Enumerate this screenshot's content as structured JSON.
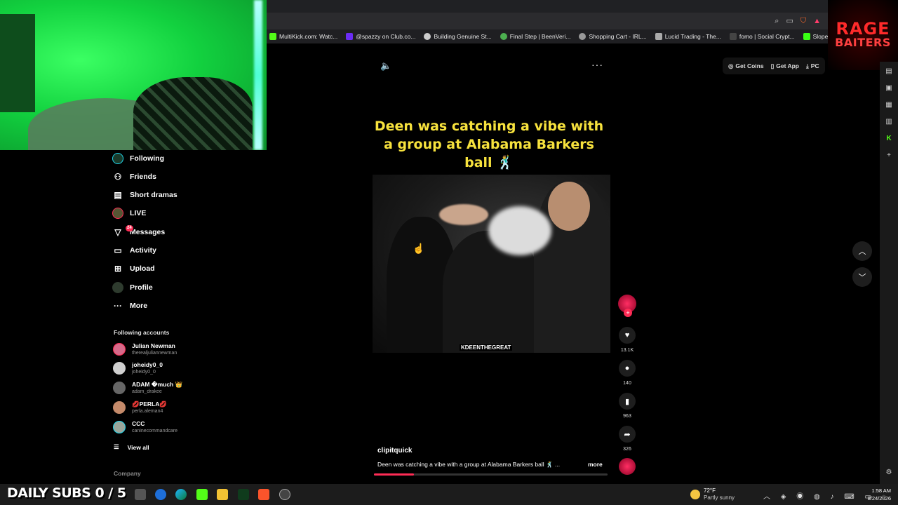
{
  "browser": {
    "bookmarks": [
      {
        "label": "MultiKick.com: Watc...",
        "icon": "kick-icon",
        "color": "#53fc18"
      },
      {
        "label": "@spazzy on Club.co...",
        "icon": "club-icon",
        "color": "#6b2cf5"
      },
      {
        "label": "Building Genuine St...",
        "icon": "doc-icon",
        "color": "#cccccc"
      },
      {
        "label": "Final Step | BeenVeri...",
        "icon": "beenverified-icon",
        "color": "#4caf50"
      },
      {
        "label": "Shopping Cart - IRL...",
        "icon": "globe-icon",
        "color": "#999999"
      },
      {
        "label": "Lucid Trading - The...",
        "icon": "lucid-icon",
        "color": "#aaaaaa"
      },
      {
        "label": "fomo | Social Crypt...",
        "icon": "fomo-icon",
        "color": "#222222"
      },
      {
        "label": "Slope Game",
        "icon": "slope-icon",
        "color": "#39ff14"
      }
    ]
  },
  "overlay": {
    "logo_top": "RAGE",
    "logo_bottom": "BAITERS",
    "daily_subs": "DAILY SUBS 0 / 5"
  },
  "sidebar": {
    "nav": [
      {
        "label": "Following",
        "icon": "following-avatar-icon"
      },
      {
        "label": "Friends",
        "icon": "friends-icon"
      },
      {
        "label": "Short dramas",
        "icon": "short-dramas-icon"
      },
      {
        "label": "LIVE",
        "icon": "live-icon"
      },
      {
        "label": "Messages",
        "icon": "messages-icon",
        "badge": "24"
      },
      {
        "label": "Activity",
        "icon": "activity-icon"
      },
      {
        "label": "Upload",
        "icon": "upload-icon"
      },
      {
        "label": "Profile",
        "icon": "profile-avatar-icon"
      },
      {
        "label": "More",
        "icon": "more-icon"
      }
    ],
    "following_title": "Following accounts",
    "accounts": [
      {
        "name": "Julian Newman",
        "handle": "therealjuliannewman",
        "color": "#d66a8a"
      },
      {
        "name": "joheidy0_0",
        "handle": "joheidy0_0",
        "color": "#cfcfcf"
      },
      {
        "name": "ADAM �much 👑",
        "handle": "adam_drakee",
        "color": "#666666"
      },
      {
        "name": "💋PERLA💋",
        "handle": "perla.aleman4",
        "color": "#c48a6a"
      },
      {
        "name": "CCC",
        "handle": "caninecommandcare",
        "color": "#9aa59a"
      }
    ],
    "view_all": "View all",
    "company": "Company"
  },
  "topbar": {
    "get_coins": "Get Coins",
    "get_app": "Get App",
    "pc": "PC"
  },
  "video": {
    "caption": "Deen was catching a vibe with a group at Alabama Barkers ball 🕺",
    "watermark": "KDEENTHEGREAT",
    "author": "clipitquick",
    "description": "Deen was catching a vibe with a group at Alabama Barkers ball 🕺 ...",
    "more": "more",
    "progress": 0.17
  },
  "actions": {
    "likes": "13.1K",
    "comments": "140",
    "saves": "963",
    "shares": "326"
  },
  "taskbar": {
    "temp": "72°F",
    "weather": "Partly sunny",
    "time": "1:58 AM",
    "date": "8/24/2026"
  }
}
